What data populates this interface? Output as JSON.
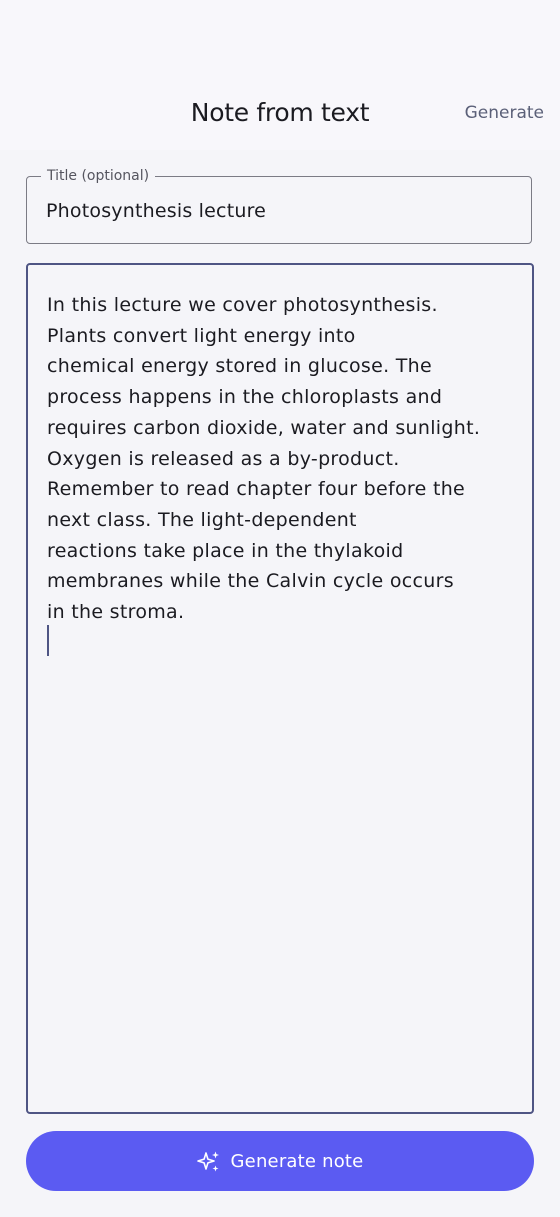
{
  "header": {
    "title": "Note from text",
    "action_label": "Generate"
  },
  "title_field": {
    "label": "Title (optional)",
    "value": "Photosynthesis lecture"
  },
  "body_field": {
    "lines": [
      "In this lecture we cover photosynthesis.",
      "Plants convert light energy into",
      "chemical energy stored in glucose. The",
      "process happens in the chloroplasts and",
      "requires carbon dioxide, water and sunlight.",
      "Oxygen is released as a by-product.",
      "Remember to read chapter four before the",
      "next class. The light-dependent",
      "reactions take place in the thylakoid",
      "membranes while the Calvin cycle occurs",
      "in the stroma."
    ]
  },
  "generate_button": {
    "icon": "sparkle-icon",
    "label": "Generate note"
  },
  "colors": {
    "accent": "#5b5bf2",
    "focus_border": "#4f5584",
    "background": "#f5f5f9"
  }
}
